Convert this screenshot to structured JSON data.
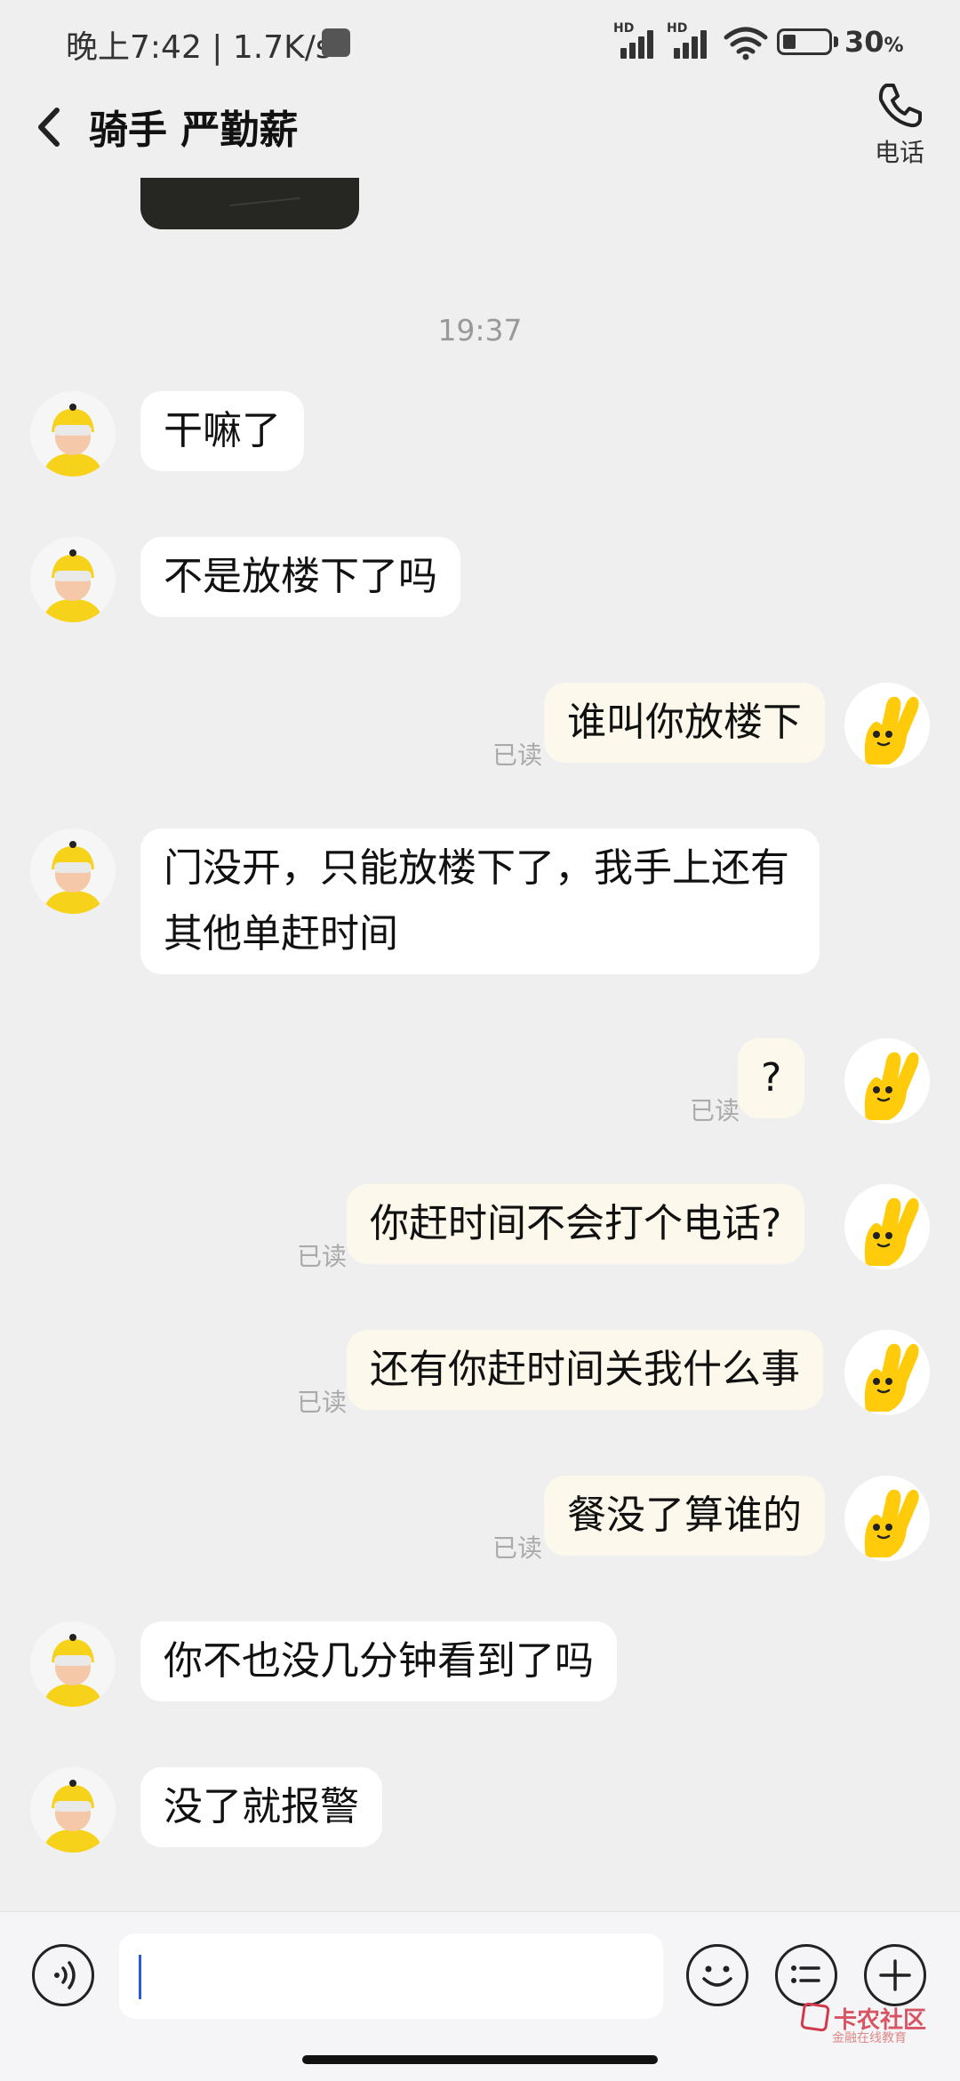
{
  "status_bar": {
    "time_speed": "晚上7:42 | 1.7K/s",
    "hd1": "HD",
    "hd2": "HD",
    "battery": "30",
    "battery_unit": "%",
    "battery_level": 0.3
  },
  "header": {
    "title": "骑手 严勤薪",
    "phone_label": "电话"
  },
  "timestamp": "19:37",
  "read_label": "已读",
  "messages": [
    {
      "side": "in",
      "text": "干嘛了"
    },
    {
      "side": "in",
      "text": "不是放楼下了吗"
    },
    {
      "side": "out",
      "text": "谁叫你放楼下",
      "read": "已读"
    },
    {
      "side": "in",
      "text": "门没开，只能放楼下了，我手上还有其他单赶时间"
    },
    {
      "side": "out",
      "text": "?",
      "read": "已读"
    },
    {
      "side": "out",
      "text": "你赶时间不会打个电话?",
      "read": "已读"
    },
    {
      "side": "out",
      "text": "还有你赶时间关我什么事",
      "read": "已读"
    },
    {
      "side": "out",
      "text": "餐没了算谁的",
      "read": "已读"
    },
    {
      "side": "in",
      "text": "你不也没几分钟看到了吗"
    },
    {
      "side": "in",
      "text": "没了就报警"
    }
  ],
  "input": {
    "value": "",
    "placeholder": ""
  },
  "watermark": {
    "text": "卡农社区",
    "sub": "金融在线教育"
  },
  "icons": {
    "back": "chevron-left-icon",
    "phone": "phone-icon",
    "voice": "voice-icon",
    "emoji": "emoji-icon",
    "quick_reply": "list-icon",
    "more": "plus-icon"
  }
}
